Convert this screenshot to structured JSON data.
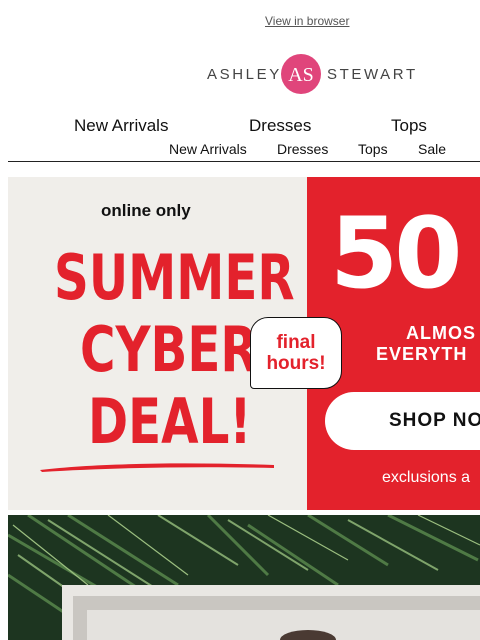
{
  "header": {
    "view_in_browser": "View in browser"
  },
  "logo": {
    "left_text": "ASHLEY",
    "right_text": "STEWART",
    "monogram": "AS",
    "colors": {
      "text": "#444444",
      "monogram": "#e0457b"
    }
  },
  "nav_primary": [
    "New Arrivals",
    "Dresses",
    "Tops"
  ],
  "nav_secondary": [
    "New Arrivals",
    "Dresses",
    "Tops",
    "Sale"
  ],
  "banner": {
    "online_only": "online only",
    "line1": "SUMMER",
    "line2": "CYBER",
    "line3": "DEAL!",
    "final_hours_1": "final",
    "final_hours_2": "hours!",
    "discount": "50",
    "almost": "ALMOS",
    "everything": "EVERYTH",
    "cta": "SHOP NO",
    "exclusions": "exclusions a",
    "colors": {
      "red": "#e3222c",
      "background": "#f0eeea",
      "white": "#ffffff"
    }
  },
  "hero": {
    "image": "palm-leaves-photo"
  }
}
